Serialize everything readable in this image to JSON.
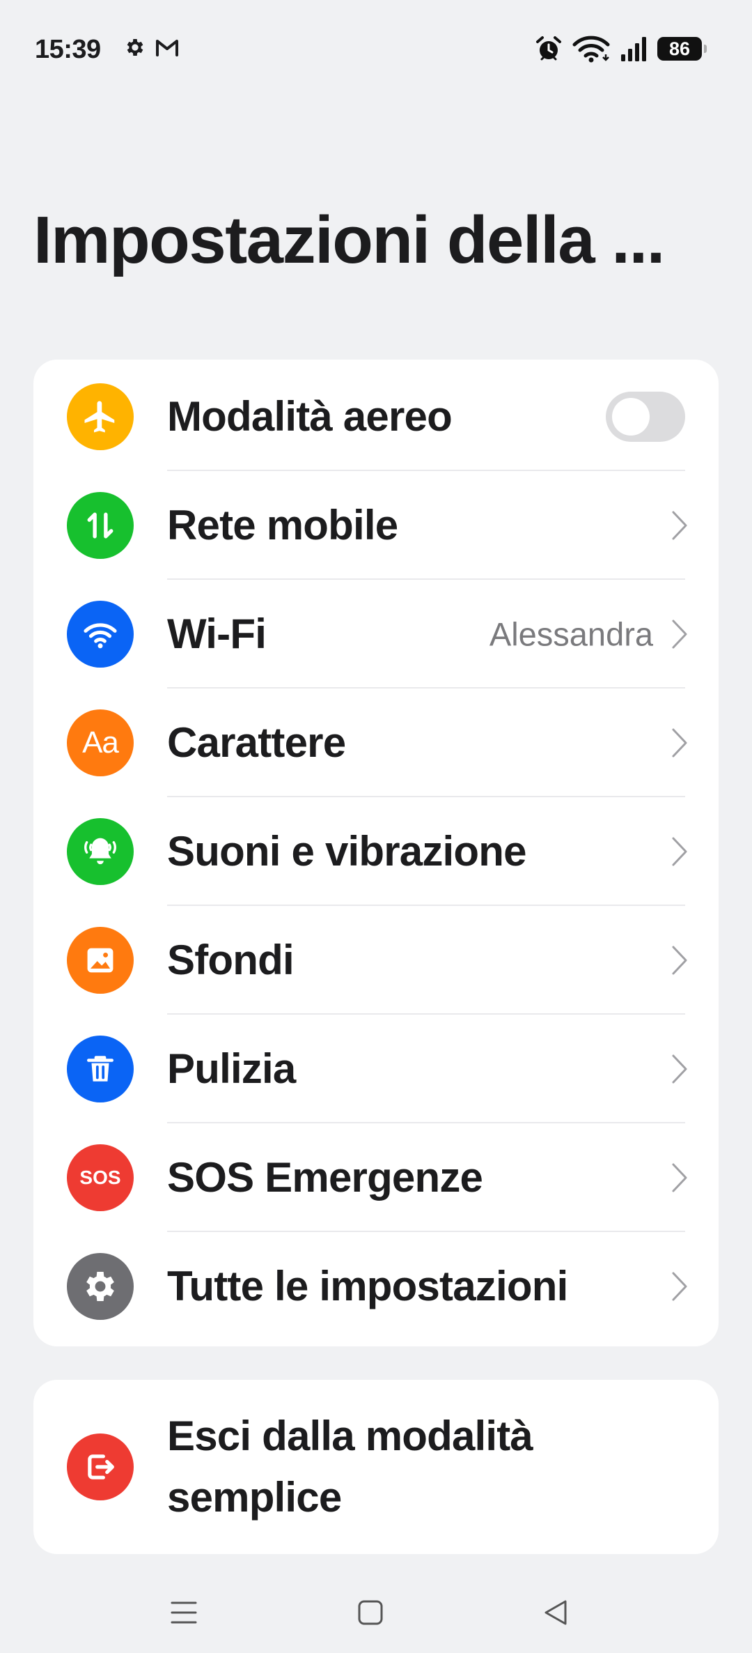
{
  "status_bar": {
    "time": "15:39",
    "left_icons": [
      "gear-icon",
      "gmail-icon"
    ],
    "right_icons": [
      "alarm-icon",
      "wifi-icon",
      "signal-icon"
    ],
    "battery_level": "86"
  },
  "page": {
    "title": "Impostazioni della ..."
  },
  "settings": [
    {
      "label": "Modalità aereo",
      "icon": "airplane-icon",
      "color": "#FFB300",
      "control": "toggle",
      "toggle_on": false
    },
    {
      "label": "Rete mobile",
      "icon": "mobile-data-icon",
      "color": "#17C02E",
      "control": "chevron"
    },
    {
      "label": "Wi-Fi",
      "icon": "wifi-icon",
      "color": "#0A64F5",
      "value": "Alessandra",
      "control": "chevron"
    },
    {
      "label": "Carattere",
      "icon": "font-icon",
      "color": "#FF7A0F",
      "icon_text": "Aa",
      "control": "chevron"
    },
    {
      "label": "Suoni e vibrazione",
      "icon": "bell-icon",
      "color": "#17C02E",
      "control": "chevron"
    },
    {
      "label": "Sfondi",
      "icon": "wallpaper-icon",
      "color": "#FF7A0F",
      "control": "chevron"
    },
    {
      "label": "Pulizia",
      "icon": "trash-icon",
      "color": "#0A64F5",
      "control": "chevron"
    },
    {
      "label": "SOS Emergenze",
      "icon": "sos-icon",
      "color": "#EE3B32",
      "icon_text": "SOS",
      "control": "chevron"
    },
    {
      "label": "Tutte le impostazioni",
      "icon": "gear-icon",
      "color": "#6E6E72",
      "control": "chevron"
    }
  ],
  "exit": {
    "label": "Esci dalla modalità semplice",
    "icon": "exit-icon",
    "color": "#EE3B32"
  },
  "nav_bar": {
    "buttons": [
      "menu-icon",
      "home-icon",
      "back-icon"
    ]
  }
}
